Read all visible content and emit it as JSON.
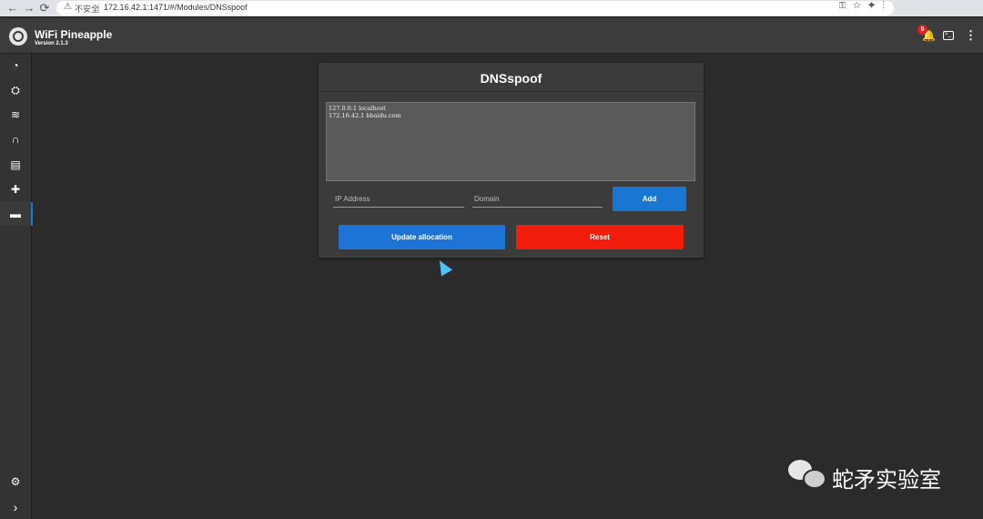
{
  "browser": {
    "back_icon": "arrow-left-icon",
    "forward_icon": "arrow-right-icon",
    "reload_icon": "reload-icon",
    "insecure_label": "不安全",
    "url": "172.16.42.1:1471/#/Modules/DNSspoof"
  },
  "app": {
    "title": "WiFi Pineapple",
    "version": "Version 2.1.3"
  },
  "topbar": {
    "notification_count": "5"
  },
  "sidebar": {
    "items": [
      {
        "icon": "dashboard-gauge-icon",
        "glyph": "◔"
      },
      {
        "icon": "campaigns-bag-icon",
        "glyph": "⛭"
      },
      {
        "icon": "wifi-icon",
        "glyph": "≋"
      },
      {
        "icon": "recon-binoculars-icon",
        "glyph": "∩"
      },
      {
        "icon": "logs-document-icon",
        "glyph": "▤"
      },
      {
        "icon": "modules-puzzle-icon",
        "glyph": "✚"
      },
      {
        "icon": "dnsspoof-module-icon",
        "glyph": "▬"
      }
    ],
    "settings_icon": "gear-icon",
    "settings_glyph": "⚙",
    "expand_glyph": "›"
  },
  "card": {
    "title": "DNSspoof",
    "hosts_lines": [
      "127.0.0.1 localhost",
      "172.16.42.1 bbaidu.com"
    ],
    "ip_placeholder": "IP Address",
    "domain_placeholder": "Domain",
    "add_label": "Add",
    "update_label": "Update allocation",
    "reset_label": "Reset"
  },
  "watermark": {
    "text": "蛇矛实验室"
  },
  "colors": {
    "primary": "#1976d2",
    "danger": "#f21d0c",
    "background": "#2b2b2b",
    "card": "#3b3b3b"
  }
}
